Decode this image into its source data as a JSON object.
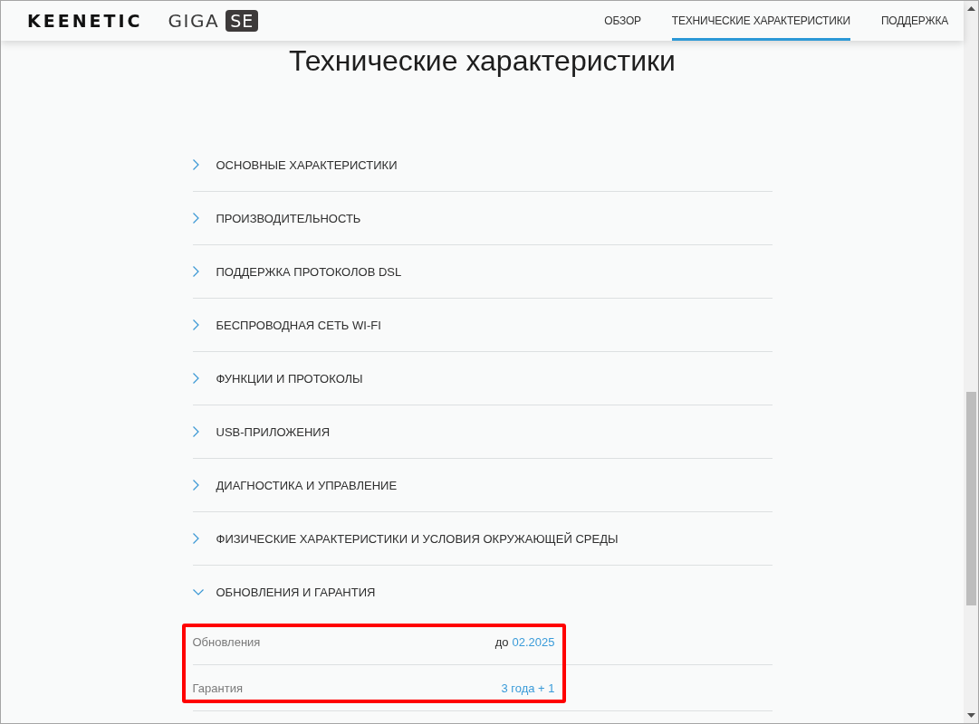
{
  "header": {
    "logo": "KEENETIC",
    "model": "GIGA",
    "model_badge": "SE",
    "nav": [
      {
        "label": "ОБЗОР",
        "selected": false
      },
      {
        "label": "ТЕХНИЧЕСКИЕ ХАРАКТЕРИСТИКИ",
        "selected": true
      },
      {
        "label": "ПОДДЕРЖКА",
        "selected": false
      }
    ]
  },
  "page_title": "Технические характеристики",
  "sections": [
    {
      "title": "ОСНОВНЫЕ ХАРАКТЕРИСТИКИ",
      "expanded": false,
      "highlighted": false
    },
    {
      "title": "ПРОИЗВОДИТЕЛЬНОСТЬ",
      "expanded": false,
      "highlighted": false
    },
    {
      "title": "ПОДДЕРЖКА ПРОТОКОЛОВ DSL",
      "expanded": false,
      "highlighted": false
    },
    {
      "title": "БЕСПРОВОДНАЯ СЕТЬ WI-FI",
      "expanded": false,
      "highlighted": false
    },
    {
      "title": "ФУНКЦИИ И ПРОТОКОЛЫ",
      "expanded": false,
      "highlighted": false
    },
    {
      "title": "USB-ПРИЛОЖЕНИЯ",
      "expanded": false,
      "highlighted": false
    },
    {
      "title": "ДИАГНОСТИКА И УПРАВЛЕНИЕ",
      "expanded": false,
      "highlighted": false
    },
    {
      "title": "ФИЗИЧЕСКИЕ ХАРАКТЕРИСТИКИ И УСЛОВИЯ ОКРУЖАЮЩЕЙ СРЕДЫ",
      "expanded": false,
      "highlighted": false
    },
    {
      "title": "ОБНОВЛЕНИЯ И ГАРАНТИЯ",
      "expanded": true,
      "highlighted": true,
      "rows": [
        {
          "label": "Обновления",
          "prefix": "до",
          "value": "02.2025"
        },
        {
          "label": "Гарантия",
          "value": "3 года + 1"
        }
      ]
    }
  ]
}
